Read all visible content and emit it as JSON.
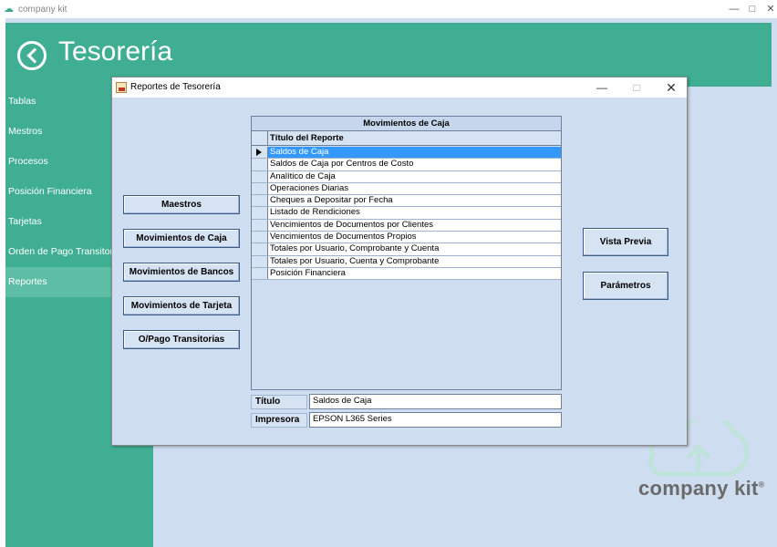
{
  "app": {
    "title": "company kit",
    "icon": "cloud-icon"
  },
  "header": {
    "title": "Tesorería",
    "back_icon": "back-arrow-icon"
  },
  "sidebar": {
    "items": [
      {
        "label": "Tablas"
      },
      {
        "label": "Mestros"
      },
      {
        "label": "Procesos"
      },
      {
        "label": "Posición Financiera"
      },
      {
        "label": "Tarjetas"
      },
      {
        "label": "Orden de Pago Transitoria"
      },
      {
        "label": "Reportes",
        "active": true
      }
    ]
  },
  "dialog": {
    "title": "Reportes de Tesorería",
    "left_buttons": [
      "Maestros",
      "Movimientos de Caja",
      "Movimientos de Bancos",
      "Movimientos de Tarjeta",
      "O/Pago Transitorias"
    ],
    "grid": {
      "caption": "Movimientos de Caja",
      "column": "Título del Reporte",
      "rows": [
        "Saldos de Caja",
        "Saldos de Caja por Centros de Costo",
        "Analítico de Caja",
        "Operaciones Diarias",
        "Cheques a Depositar por Fecha",
        "Listado de Rendiciones",
        "Vencimientos de Documentos por Clientes",
        "Vencimientos de Documentos Propios",
        "Totales por Usuario, Comprobante y Cuenta",
        "Totales por Usuario, Cuenta y Comprobante",
        "Posición Financiera"
      ],
      "selected_index": 0
    },
    "fields": {
      "titulo_label": "Título",
      "titulo_value": "Saldos de Caja",
      "impresora_label": "Impresora",
      "impresora_value": "EPSON L365 Series"
    },
    "right_buttons": {
      "preview": "Vista Previa",
      "params": "Parámetros"
    }
  },
  "watermark": {
    "text": "company kit",
    "reg": "®"
  },
  "colors": {
    "brand_green": "#3fae93",
    "panel_blue": "#cfddf0",
    "selection": "#3399ff"
  }
}
